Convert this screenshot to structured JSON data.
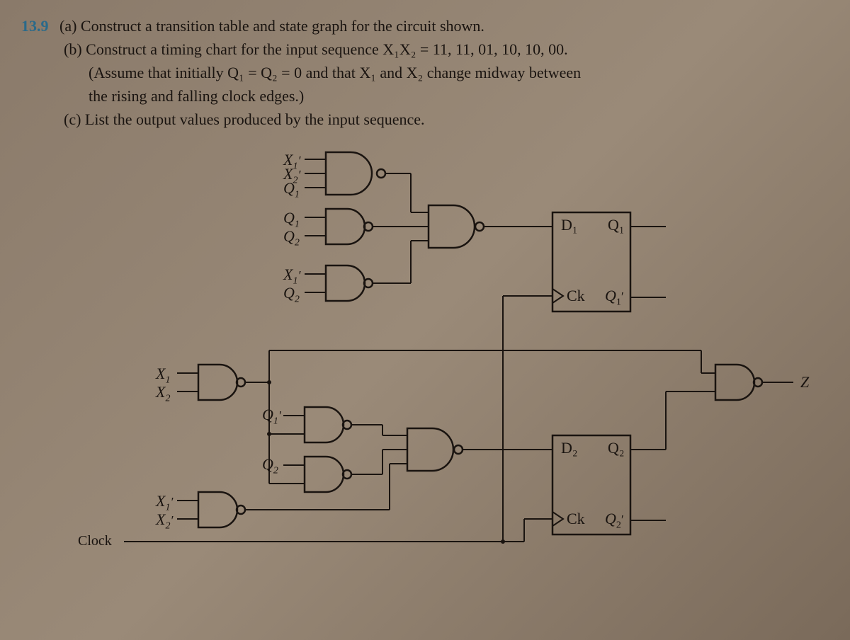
{
  "problem": {
    "number": "13.9",
    "part_a": "(a) Construct a transition table and state graph for the circuit shown.",
    "part_b_line1": "(b) Construct a timing chart for the input sequence X₁X₂ = 11, 11, 01, 10, 10, 00.",
    "part_b_line2": "(Assume that initially Q₁ = Q₂ = 0 and that X₁ and X₂ change midway between",
    "part_b_line3": "the rising and falling clock edges.)",
    "part_c": "(c) List the output values produced by the input sequence."
  },
  "circuit": {
    "gate1_inputs": [
      "X₁'",
      "X₂'",
      "Q₁"
    ],
    "gate2_inputs": [
      "Q₁",
      "Q₂"
    ],
    "gate3_inputs": [
      "X₁'",
      "Q₂"
    ],
    "gate4_inputs": [
      "X₁",
      "X₂"
    ],
    "gate5_input": "Q₁'",
    "gate6_input": "Q₂",
    "gate7_inputs": [
      "X₁'",
      "X₂'"
    ],
    "ff1": {
      "d": "D₁",
      "q": "Q₁",
      "ck": "Ck",
      "qbar": "Q₁'"
    },
    "ff2": {
      "d": "D₂",
      "q": "Q₂",
      "ck": "Ck",
      "qbar": "Q₂'"
    },
    "output": "Z",
    "clock": "Clock"
  },
  "chart_data": {
    "type": "diagram",
    "description": "Sequential logic circuit with two D flip-flops",
    "flip_flops": 2,
    "inputs": [
      "X₁",
      "X₂",
      "Clock"
    ],
    "outputs": [
      "Z"
    ],
    "state_variables": [
      "Q₁",
      "Q₂"
    ],
    "gates": [
      {
        "type": "NAND",
        "inputs": [
          "X₁'",
          "X₂'",
          "Q₁"
        ]
      },
      {
        "type": "NAND",
        "inputs": [
          "Q₁",
          "Q₂"
        ]
      },
      {
        "type": "NAND",
        "inputs": [
          "X₁'",
          "Q₂"
        ]
      },
      {
        "type": "NAND3",
        "output": "D₁"
      },
      {
        "type": "NAND",
        "inputs": [
          "X₁",
          "X₂"
        ]
      },
      {
        "type": "NAND",
        "inputs": [
          "Q₁'",
          "wire"
        ]
      },
      {
        "type": "NAND",
        "inputs": [
          "Q₂",
          "wire"
        ]
      },
      {
        "type": "NAND",
        "inputs": [
          "X₁'",
          "X₂'"
        ]
      },
      {
        "type": "NAND3",
        "output": "D₂"
      },
      {
        "type": "NAND",
        "output": "Z"
      }
    ]
  }
}
